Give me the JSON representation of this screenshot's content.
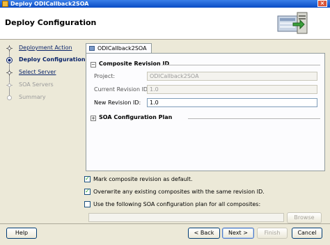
{
  "window": {
    "title": "Deploy ODICallback2SOA"
  },
  "header": {
    "title": "Deploy Configuration"
  },
  "nav": {
    "items": [
      {
        "label": "Deployment Action"
      },
      {
        "label": "Deploy Configuration"
      },
      {
        "label": "Select Server"
      },
      {
        "label": "SOA Servers"
      },
      {
        "label": "Summary"
      }
    ]
  },
  "tab": {
    "label": "ODICallback2SOA"
  },
  "composite_revision": {
    "heading": "Composite Revision ID",
    "toggle": "−",
    "project_label": "Project:",
    "project_value": "ODICallback2SOA",
    "current_label": "Current Revision ID:",
    "current_value": "1.0",
    "new_label": "New Revision ID:",
    "new_value": "1.0"
  },
  "soa_plan": {
    "heading": "SOA Configuration Plan",
    "toggle": "+"
  },
  "options": {
    "mark_default": "Mark composite revision as default.",
    "overwrite": "Overwrite any existing composites with the same revision ID.",
    "use_plan": "Use the following SOA configuration plan for all composites:",
    "check_mark": "✓"
  },
  "buttons": {
    "browse": "Browse",
    "help": "Help",
    "back": "< Back",
    "next": "Next >",
    "finish": "Finish",
    "cancel": "Cancel"
  }
}
